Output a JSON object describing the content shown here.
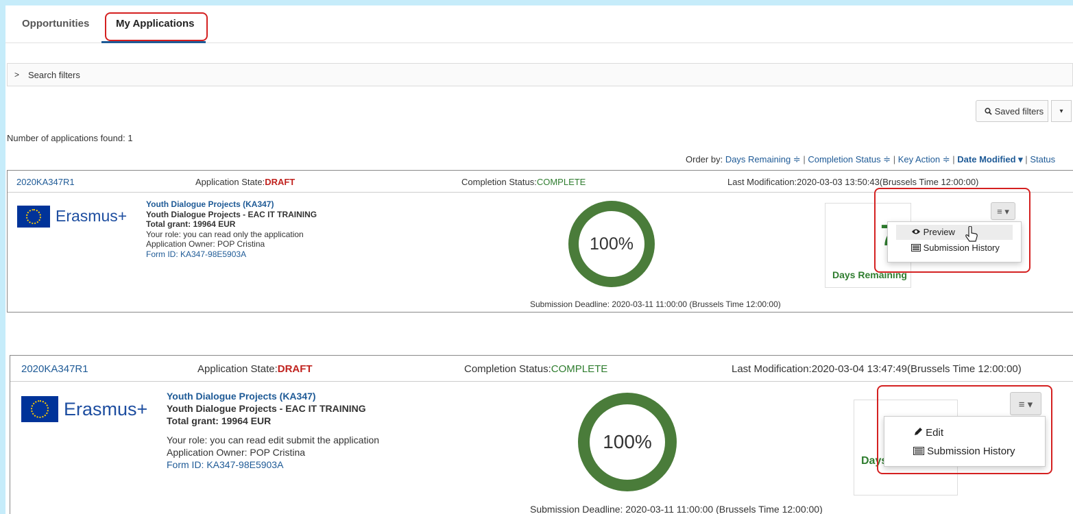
{
  "tabs": [
    "Opportunities",
    "My Applications"
  ],
  "filters": {
    "chevron": ">",
    "label": "Search filters"
  },
  "saved_filters": {
    "icon": "search-icon",
    "label": "Saved filters",
    "caret": "▾"
  },
  "results": {
    "found": "Number of applications found: 1"
  },
  "order_by": {
    "label": "Order by:",
    "options": [
      "Days Remaining ≑",
      "Completion Status ≑",
      "Key Action ≑",
      "Date Modified ▾",
      "Status"
    ],
    "separator": "|"
  },
  "colors": {
    "accent": "#1e5a96",
    "draft": "#c0221e",
    "complete": "#2f7d2f",
    "highlight": "#d42020",
    "donut": "#4a7c3a"
  },
  "applications": [
    {
      "id": "2020KA347R1",
      "state_label": "Application State:",
      "state": "DRAFT",
      "completion_label": "Completion Status:",
      "completion": "COMPLETE",
      "last_mod": "Last Modification:2020-03-03 13:50:43(Brussels Time 12:00:00)",
      "logo": "Erasmus+",
      "project": "Youth Dialogue Projects (KA347)",
      "subtitle": "Youth Dialogue Projects - EAC IT TRAINING",
      "grant": "Total grant: 19964 EUR",
      "role": "Your role: you can read only the application",
      "owner": "Application Owner: POP Cristina",
      "form_id": "Form ID: KA347-98E5903A",
      "percent": "100%",
      "completion_fraction": 1.0,
      "days_value": "7",
      "days_label": "Days Remaining",
      "menu_icon": "≡ ▾",
      "menu": [
        {
          "icon": "eye-icon",
          "label": "Preview"
        },
        {
          "icon": "list-icon",
          "label": "Submission History"
        }
      ],
      "deadline": "Submission Deadline: 2020-03-11 11:00:00 (Brussels Time 12:00:00)"
    },
    {
      "id": "2020KA347R1",
      "state_label": "Application State:",
      "state": "DRAFT",
      "completion_label": "Completion Status:",
      "completion": "COMPLETE",
      "last_mod": "Last Modification:2020-03-04 13:47:49(Brussels Time 12:00:00)",
      "logo": "Erasmus+",
      "project": "Youth Dialogue Projects (KA347)",
      "subtitle": "Youth Dialogue Projects - EAC IT TRAINING",
      "grant": "Total grant: 19964 EUR",
      "role": "Your role: you can read edit submit the application",
      "owner": "Application Owner: POP Cristina",
      "form_id": "Form ID: KA347-98E5903A",
      "percent": "100%",
      "completion_fraction": 1.0,
      "days_value": "",
      "days_label": "Days Remaining",
      "menu_icon": "≡ ▾",
      "menu": [
        {
          "icon": "pencil-icon",
          "label": "Edit"
        },
        {
          "icon": "list-icon",
          "label": "Submission History"
        }
      ],
      "deadline": "Submission Deadline: 2020-03-11 11:00:00 (Brussels Time 12:00:00)"
    }
  ]
}
